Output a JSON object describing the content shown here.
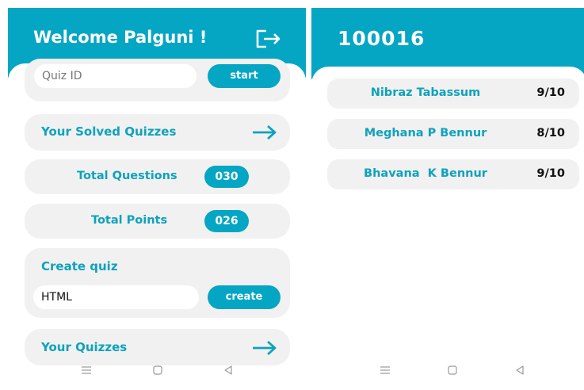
{
  "left_screen": {
    "header": {
      "title": "Welcome Palguni !",
      "logout_icon": "logout-icon"
    },
    "quiz_join": {
      "placeholder": "Quiz ID",
      "value": "",
      "button_label": "start"
    },
    "solved": {
      "label": "Your Solved Quizzes",
      "icon": "arrow-right-icon"
    },
    "total_questions": {
      "label": "Total Questions",
      "value": "030"
    },
    "total_points": {
      "label": "Total Points",
      "value": "026"
    },
    "create": {
      "heading": "Create quiz",
      "input_value": "HTML",
      "button_label": "create"
    },
    "your_quizzes": {
      "label": "Your Quizzes",
      "icon": "arrow-right-icon"
    }
  },
  "right_screen": {
    "header": {
      "title": "100016"
    },
    "results": [
      {
        "name": "Nibraz Tabassum",
        "score": "9/10"
      },
      {
        "name": "Meghana P Bennur",
        "score": "8/10"
      },
      {
        "name": "Bhavana  K Bennur",
        "score": "9/10"
      }
    ]
  },
  "colors": {
    "accent": "#04a6c3",
    "text_accent": "#0ea2bd",
    "card": "#f1f1f1"
  }
}
